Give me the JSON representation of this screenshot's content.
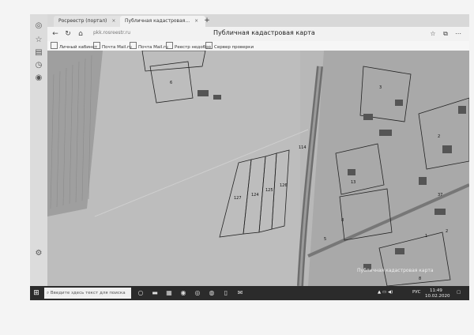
{
  "browser": {
    "tabs": [
      {
        "label": "Росреестр (портал)",
        "active": false
      },
      {
        "label": "Публичная кадастровая...",
        "active": true
      }
    ],
    "address": "pkk.rosreestr.ru",
    "page_title": "Публичная кадастровая карта",
    "bookmarks": [
      "Личный кабинет",
      "Почта Mail.ru",
      "Почта Mail.ru",
      "Реестр недобро",
      "Сервер проверки"
    ]
  },
  "map": {
    "parcel_numbers": [
      "6",
      "127",
      "124",
      "125",
      "126",
      "114",
      "13",
      "8",
      "5",
      "3",
      "2",
      "37",
      "1",
      "2",
      "8"
    ],
    "watermark": "Публичная кадастровая карта"
  },
  "taskbar": {
    "search_placeholder": "Введите здесь текст для поиска",
    "tray_lang": "РУС",
    "time": "11:49",
    "date": "10.02.2020"
  },
  "icons": [
    "windows-icon",
    "search-icon",
    "back-icon",
    "forward-icon",
    "refresh-icon",
    "home-icon",
    "star-icon",
    "menu-icon"
  ]
}
